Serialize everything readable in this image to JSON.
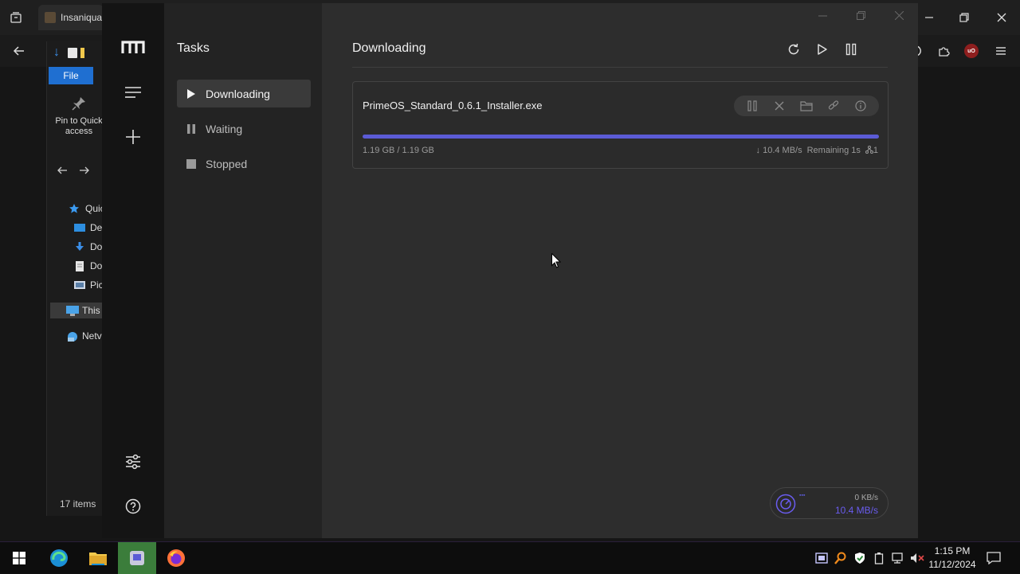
{
  "browser": {
    "tab_title": "Insaniqua",
    "ublock_label": "uO"
  },
  "explorer": {
    "file_tab": "File",
    "pin_label": "Pin to Quick access",
    "tree": [
      {
        "label": "Quic"
      },
      {
        "label": "De"
      },
      {
        "label": "Do"
      },
      {
        "label": "Do"
      },
      {
        "label": "Pic"
      },
      {
        "label": "This"
      },
      {
        "label": "Netv"
      }
    ],
    "status": "17 items"
  },
  "app": {
    "sidebar_title": "Tasks",
    "nav": [
      {
        "label": "Downloading",
        "icon": "play-icon",
        "active": true
      },
      {
        "label": "Waiting",
        "icon": "pause-icon",
        "active": false
      },
      {
        "label": "Stopped",
        "icon": "stop-icon",
        "active": false
      }
    ],
    "main_title": "Downloading",
    "task": {
      "filename": "PrimeOS_Standard_0.6.1_Installer.exe",
      "progress": 1.0,
      "size_text": "1.19 GB / 1.19 GB",
      "speed": "10.4 MB/s",
      "remaining": "Remaining 1s",
      "connections": "1"
    },
    "speed_widget": {
      "upload": "0 KB/s",
      "download": "10.4 MB/s"
    },
    "accent": "#5b5bd6"
  },
  "taskbar": {
    "time": "1:15 PM",
    "date": "11/12/2024"
  }
}
